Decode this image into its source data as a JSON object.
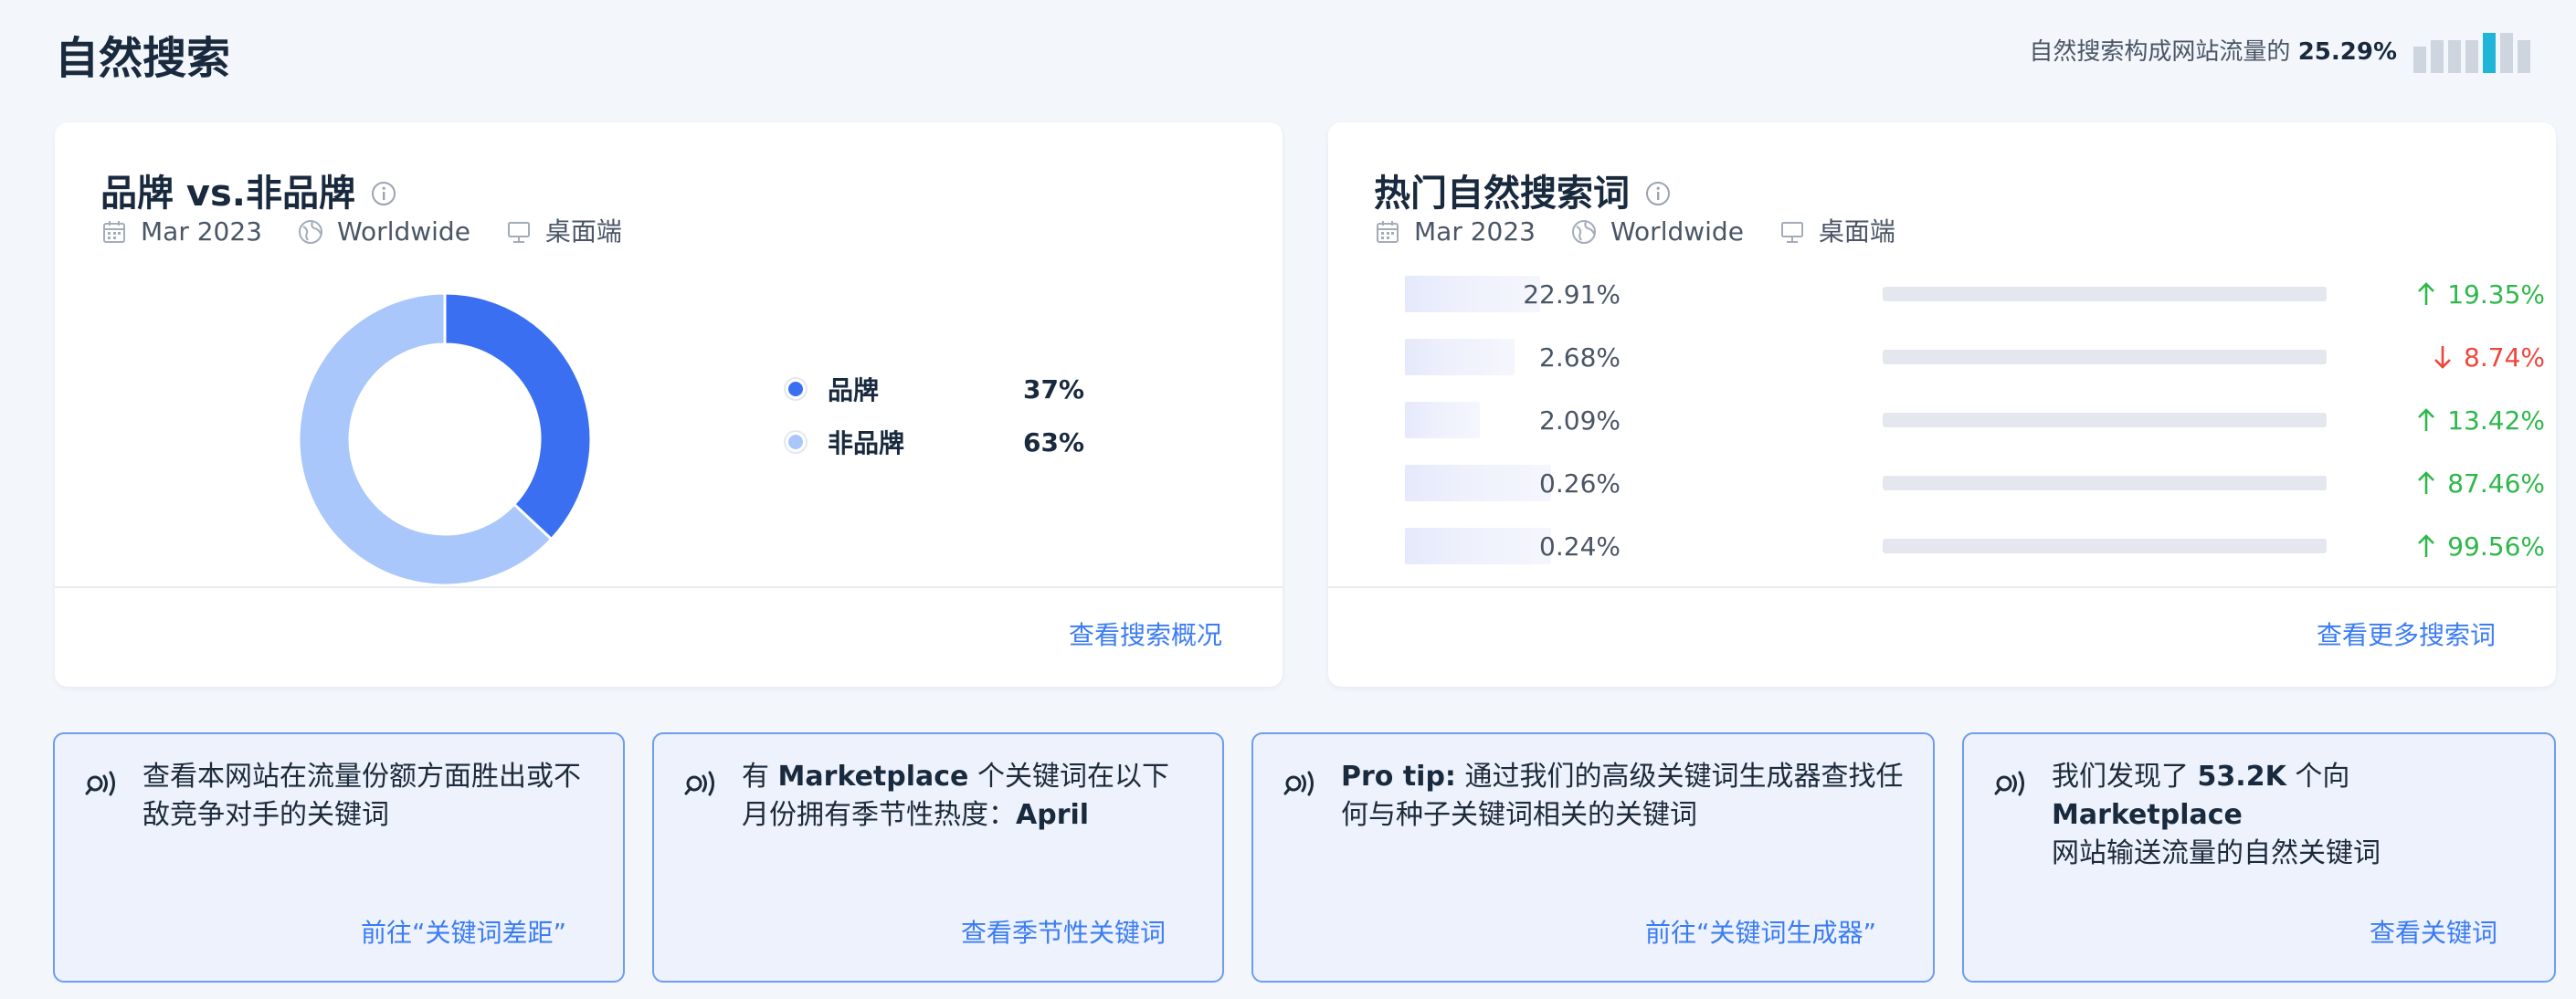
{
  "header": {
    "title": "自然搜索",
    "share_label": "自然搜索构成网站流量的",
    "share_value": "25.29%",
    "share_bars": [
      {
        "level": 0.55,
        "color": "#cfd5de"
      },
      {
        "level": 0.7,
        "color": "#cfd5de"
      },
      {
        "level": 0.7,
        "color": "#cfd5de"
      },
      {
        "level": 0.7,
        "color": "#cfd5de"
      },
      {
        "level": 0.85,
        "color": "#20b5d8"
      },
      {
        "level": 0.85,
        "color": "#cfd5de"
      },
      {
        "level": 0.7,
        "color": "#cfd5de"
      }
    ]
  },
  "brand_card": {
    "title": "品牌 vs.非品牌",
    "date": "Mar 2023",
    "region": "Worldwide",
    "device": "桌面端",
    "link": "查看搜索概况",
    "legend": [
      {
        "label": "品牌",
        "value": "37%",
        "color": "#3b6ff2"
      },
      {
        "label": "非品牌",
        "value": "63%",
        "color": "#a9c7fb"
      }
    ]
  },
  "chart_data": {
    "type": "pie",
    "categories": [
      "品牌",
      "非品牌"
    ],
    "values": [
      37,
      63
    ],
    "colors": [
      "#3b6ff2",
      "#a9c7fb"
    ],
    "title": "品牌 vs.非品牌"
  },
  "keywords_card": {
    "title": "热门自然搜索词",
    "date": "Mar 2023",
    "region": "Worldwide",
    "device": "桌面端",
    "link": "查看更多搜索词",
    "rows": [
      {
        "share": "22.91%",
        "share_value": 22.91,
        "change": "19.35%",
        "direction": "up"
      },
      {
        "share": "2.68%",
        "share_value": 2.68,
        "change": "8.74%",
        "direction": "down"
      },
      {
        "share": "2.09%",
        "share_value": 2.09,
        "change": "13.42%",
        "direction": "up"
      },
      {
        "share": "0.26%",
        "share_value": 0.26,
        "change": "87.46%",
        "direction": "up"
      },
      {
        "share": "0.24%",
        "share_value": 0.24,
        "change": "99.56%",
        "direction": "up"
      }
    ]
  },
  "tips": [
    {
      "text_a": "查看本网站在流量份额方面胜出或不敌竞争对手的关键词",
      "bold_a": "",
      "text_b": "",
      "bold_b": "",
      "link": "前往“关键词差距”"
    },
    {
      "text_a": "有 ",
      "bold_a": "Marketplace",
      "text_b": " 个关键词在以下月份拥有季节性热度：",
      "bold_b": "April",
      "link": "查看季节性关键词"
    },
    {
      "text_a": "",
      "bold_a": "Pro tip:",
      "text_b": " 通过我们的高级关键词生成器查找任何与种子关键词相关的关键词",
      "bold_b": "",
      "link": "前往“关键词生成器”"
    },
    {
      "text_a": "我们发现了 ",
      "bold_a": "53.2K",
      "text_b": " 个向",
      "bold_b": "Marketplace",
      "text_c": "网站输送流量的自然关键词",
      "link": "查看关键词"
    }
  ]
}
